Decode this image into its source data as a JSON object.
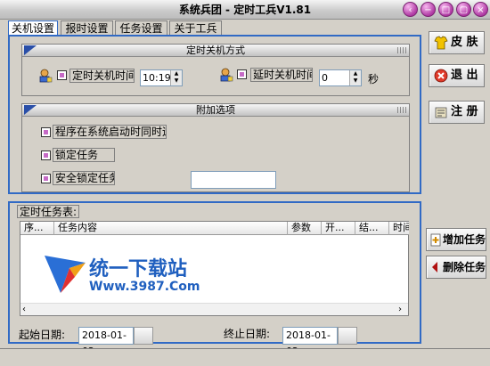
{
  "window": {
    "title": "系统兵团 - 定时工兵V1.81"
  },
  "tabs": [
    {
      "label": "关机设置",
      "active": true
    },
    {
      "label": "报时设置"
    },
    {
      "label": "任务设置"
    },
    {
      "label": "关于工兵"
    }
  ],
  "shutdown_group": {
    "header": "定时关机方式",
    "timed_label": "定时关机时间",
    "timed_value": "10:19",
    "delay_label": "延时关机时间",
    "delay_value": "0",
    "delay_unit": "秒"
  },
  "extra_group": {
    "header": "附加选项",
    "opt1": "程序在系统启动时同时运行",
    "opt2": "锁定任务",
    "opt3": "安全锁定任务",
    "password_value": ""
  },
  "right_buttons": {
    "skin": "皮 肤",
    "exit": "退 出",
    "register": "注 册",
    "add_task": "增加任务",
    "delete_task": "删除任务"
  },
  "tasks": {
    "title": "定时任务表:",
    "columns": [
      "序...",
      "任务内容",
      "参数",
      "开...",
      "结...",
      "时间"
    ],
    "rows": []
  },
  "dates": {
    "start_label": "起始日期:",
    "start_value": "2018-01-02",
    "end_label": "终止日期:",
    "end_value": "2018-01-02"
  },
  "watermark": {
    "name": "统一下载站",
    "url": "Www.3987.Com"
  },
  "colors": {
    "accent": "#316ac5",
    "window_bg": "#d4d0c8",
    "checkbox_mark": "#c66ac6"
  },
  "icons": [
    "minimize-icon",
    "restore-icon",
    "maximize-icon",
    "close-icon",
    "shirt-icon",
    "exit-icon",
    "register-icon",
    "add-task-icon",
    "delete-task-icon",
    "user-lock-icon"
  ]
}
